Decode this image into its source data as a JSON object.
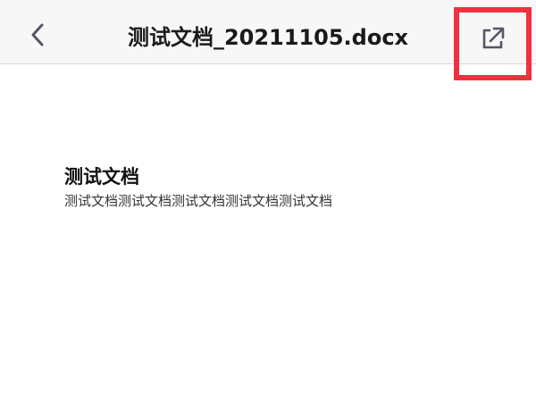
{
  "navbar": {
    "title": "测试文档_20211105.docx",
    "back_icon": "chevron-left-icon",
    "open_icon": "external-link-icon"
  },
  "document": {
    "heading": "测试文档",
    "body": "测试文档测试文档测试文档测试文档测试文档"
  },
  "colors": {
    "highlight": "#f3303f",
    "navbar_bg": "#f7f7f7",
    "icon": "#555566"
  }
}
